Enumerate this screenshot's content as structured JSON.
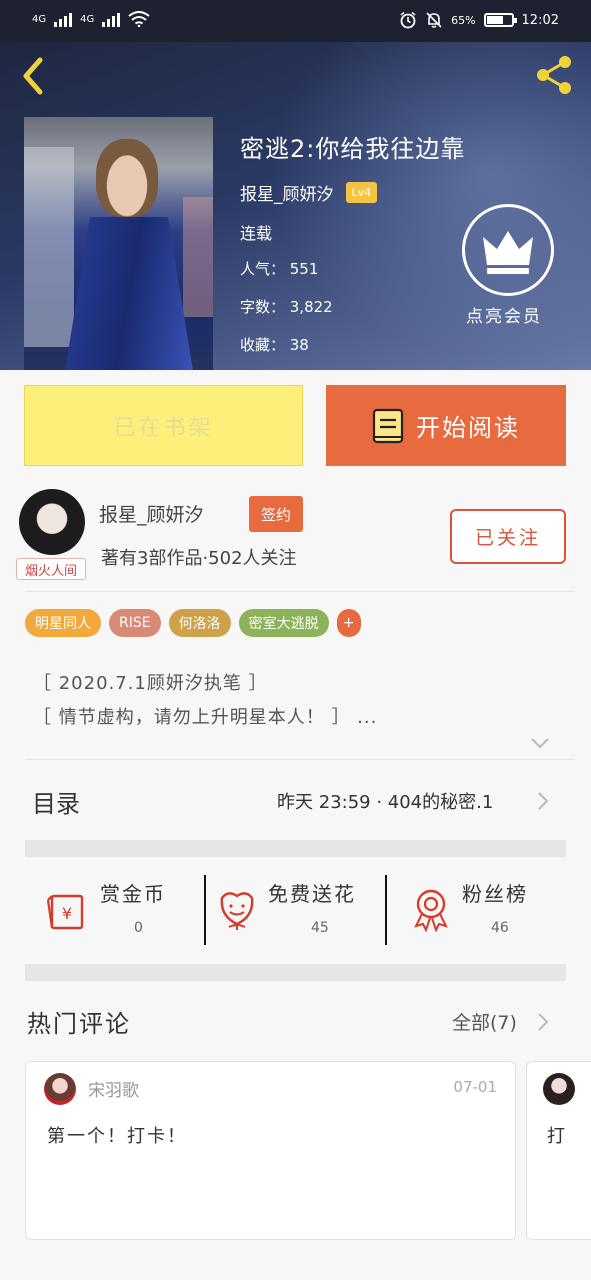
{
  "status_bar": {
    "net1": "4G",
    "net2": "4G",
    "battery_pct": "65%",
    "battery_level": 0.65,
    "time": "12:02"
  },
  "book": {
    "title": "密逃2:你给我往边靠",
    "author": "报星_顾妍汐",
    "level": "Lv4",
    "status": "连载",
    "popularity": "人气： 551",
    "word_count": "字数： 3,822",
    "favorites": "收藏： 38",
    "vip_label": "点亮会员"
  },
  "actions": {
    "shelf_label": "已在书架",
    "read_label": "开始阅读"
  },
  "author_card": {
    "name": "报星_顾妍汐",
    "badge": "签约",
    "meta": "著有3部作品·502人关注",
    "avatar_tag": "烟火人间",
    "follow_label": "已关注"
  },
  "tags": [
    {
      "label": "明星同人",
      "color": "#f2a93b"
    },
    {
      "label": "RISE",
      "color": "#d98a77"
    },
    {
      "label": "何洛洛",
      "color": "#cda24a"
    },
    {
      "label": "密室大逃脱",
      "color": "#8db35a"
    }
  ],
  "tag_add": "+",
  "description": {
    "line1": "［ 2020.7.1顾妍汐执笔 ］",
    "line2": "［ 情节虚构，请勿上升明星本人！ ］ ..."
  },
  "toc": {
    "title": "目录",
    "latest": "昨天 23:59 · 404的秘密.1"
  },
  "stats": [
    {
      "label": "赏金币",
      "value": "0"
    },
    {
      "label": "免费送花",
      "value": "45"
    },
    {
      "label": "粉丝榜",
      "value": "46"
    }
  ],
  "comments": {
    "title": "热门评论",
    "all_label": "全部(7)",
    "items": [
      {
        "user": "宋羽歌",
        "date": "07-01",
        "text": "第一个！打卡！"
      },
      {
        "text": "打"
      }
    ]
  },
  "colors": {
    "accent": "#e86a3f",
    "shelf_yellow": "#fdf07a",
    "follow_red": "#d9533b",
    "icon_red": "#d63a2a"
  }
}
